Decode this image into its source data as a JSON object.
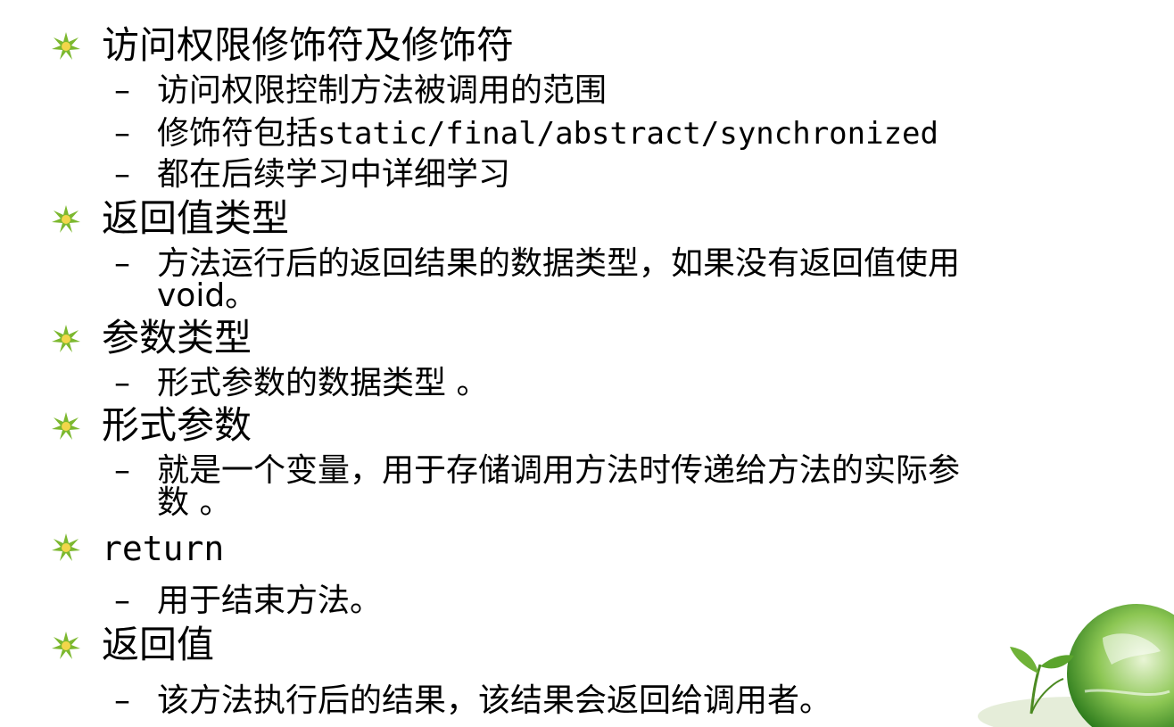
{
  "items": [
    {
      "title": "访问权限修饰符及修饰符",
      "subs": [
        [
          "访问权限控制方法被调用的范围"
        ],
        [
          "修饰符包括",
          "static/final/abstract/synchronized"
        ],
        [
          "都在后续学习中详细学习"
        ]
      ]
    },
    {
      "title": "返回值类型",
      "subs": [
        [
          "方法运行后的返回结果的数据类型，如果没有返回值使用",
          "void。"
        ]
      ]
    },
    {
      "title": "参数类型",
      "subs": [
        [
          "形式参数的数据类型 。"
        ]
      ]
    },
    {
      "title": "形式参数",
      "subs": [
        [
          "就是一个变量，用于存储调用方法时传递给方法的实际参",
          "数 。"
        ]
      ]
    },
    {
      "title": "return",
      "subs": [
        [
          "用于结束方法。"
        ]
      ]
    },
    {
      "title": "返回值",
      "subs": [
        [
          "该方法执行后的结果，该结果会返回给调用者。"
        ]
      ]
    }
  ],
  "dash_symbol": "–",
  "colors": {
    "bullet_green": "#7cb82f",
    "bullet_center": "#f2d64a",
    "text": "#000000"
  },
  "icons": {
    "bullet": "starburst-bullet-icon",
    "decor": "globe-plant-decoration"
  }
}
